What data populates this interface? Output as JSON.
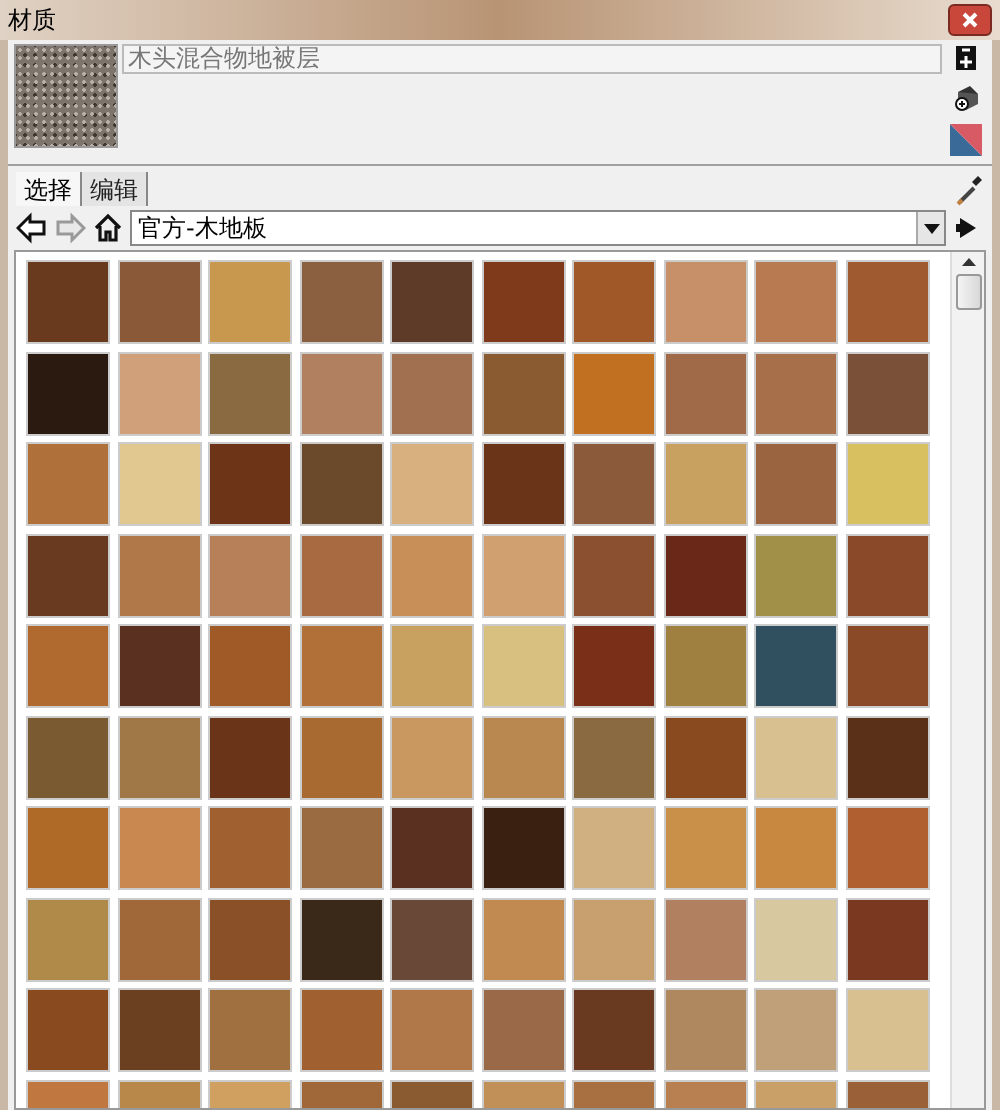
{
  "window": {
    "title": "材质"
  },
  "material": {
    "name": "木头混合物地被层"
  },
  "tabs": [
    {
      "label": "选择",
      "selected": true
    },
    {
      "label": "编辑",
      "selected": false
    }
  ],
  "library": {
    "value": "官方-木地板"
  },
  "swatch_rows": [
    {
      "swatches": [
        {
          "color": "#6a3a1e"
        },
        {
          "color": "#8a5a38"
        },
        {
          "color": "#c8984e"
        },
        {
          "color": "#8a6040"
        },
        {
          "color": "#5e3a28"
        },
        {
          "color": "#7e3a1a"
        },
        {
          "color": "#a05828"
        },
        {
          "color": "#c89068"
        },
        {
          "color": "#b87a50"
        },
        {
          "color": "#a05a30"
        }
      ]
    },
    {
      "swatches": [
        {
          "color": "#2a1a10"
        },
        {
          "color": "#d0a07a"
        },
        {
          "color": "#8a6a40"
        },
        {
          "color": "#b08060"
        },
        {
          "color": "#a07050"
        },
        {
          "color": "#8a5a30"
        },
        {
          "color": "#c07020"
        },
        {
          "color": "#a06a48"
        },
        {
          "color": "#a8704a"
        },
        {
          "color": "#7a5038"
        }
      ]
    },
    {
      "swatches": [
        {
          "color": "#b0703a"
        },
        {
          "color": "#e0c890"
        },
        {
          "color": "#6e3418"
        },
        {
          "color": "#6a4a2a"
        },
        {
          "color": "#d8b080"
        },
        {
          "color": "#6a3418"
        },
        {
          "color": "#8a5a3a"
        },
        {
          "color": "#c8a060"
        },
        {
          "color": "#9a6440"
        },
        {
          "color": "#d8c060"
        }
      ]
    },
    {
      "swatches": [
        {
          "color": "#6a3a20"
        },
        {
          "color": "#b07848"
        },
        {
          "color": "#b88058"
        },
        {
          "color": "#a86a40"
        },
        {
          "color": "#c89058"
        },
        {
          "color": "#d0a070"
        },
        {
          "color": "#8a5030"
        },
        {
          "color": "#6a2818"
        },
        {
          "color": "#a09048"
        },
        {
          "color": "#8a4a2a"
        }
      ]
    },
    {
      "swatches": [
        {
          "color": "#b06a30"
        },
        {
          "color": "#5a3020"
        },
        {
          "color": "#a05a28"
        },
        {
          "color": "#b07038"
        },
        {
          "color": "#c8a060"
        },
        {
          "color": "#d8c080"
        },
        {
          "color": "#7a3018"
        },
        {
          "color": "#a08040"
        },
        {
          "color": "#305060"
        },
        {
          "color": "#8a4a28"
        }
      ]
    },
    {
      "swatches": [
        {
          "color": "#7a5a30"
        },
        {
          "color": "#a07848"
        },
        {
          "color": "#6a3418"
        },
        {
          "color": "#a86a30"
        },
        {
          "color": "#c89860"
        },
        {
          "color": "#b88850"
        },
        {
          "color": "#8a6a40"
        },
        {
          "color": "#8a4a20"
        },
        {
          "color": "#d8c090"
        },
        {
          "color": "#5a3018"
        }
      ]
    },
    {
      "swatches": [
        {
          "color": "#b06a28"
        },
        {
          "color": "#c88850"
        },
        {
          "color": "#a06030"
        },
        {
          "color": "#9a6a40"
        },
        {
          "color": "#5a3020"
        },
        {
          "color": "#3a2010"
        },
        {
          "color": "#d0b080"
        },
        {
          "color": "#c89048"
        },
        {
          "color": "#c88840"
        },
        {
          "color": "#b06030"
        }
      ]
    },
    {
      "swatches": [
        {
          "color": "#b08a48"
        },
        {
          "color": "#a06838"
        },
        {
          "color": "#8a5028"
        },
        {
          "color": "#3a2818"
        },
        {
          "color": "#6a4838"
        },
        {
          "color": "#c08a50"
        },
        {
          "color": "#c8a070"
        },
        {
          "color": "#b08060"
        },
        {
          "color": "#d8c8a0"
        },
        {
          "color": "#7a3820"
        }
      ]
    },
    {
      "swatches": [
        {
          "color": "#8a4a20"
        },
        {
          "color": "#6a4020"
        },
        {
          "color": "#a07040"
        },
        {
          "color": "#a06030"
        },
        {
          "color": "#b07848"
        },
        {
          "color": "#9a6a48"
        },
        {
          "color": "#6a3a20"
        },
        {
          "color": "#b08860"
        },
        {
          "color": "#c0a078"
        },
        {
          "color": "#d8c090"
        }
      ]
    },
    {
      "swatches": [
        {
          "color": "#c07840"
        },
        {
          "color": "#b8884a"
        },
        {
          "color": "#d0a060"
        },
        {
          "color": "#a06838"
        },
        {
          "color": "#8a5a30"
        },
        {
          "color": "#c09058"
        },
        {
          "color": "#a87040"
        },
        {
          "color": "#b88050"
        },
        {
          "color": "#c8a068"
        },
        {
          "color": "#9a6038"
        }
      ]
    }
  ]
}
